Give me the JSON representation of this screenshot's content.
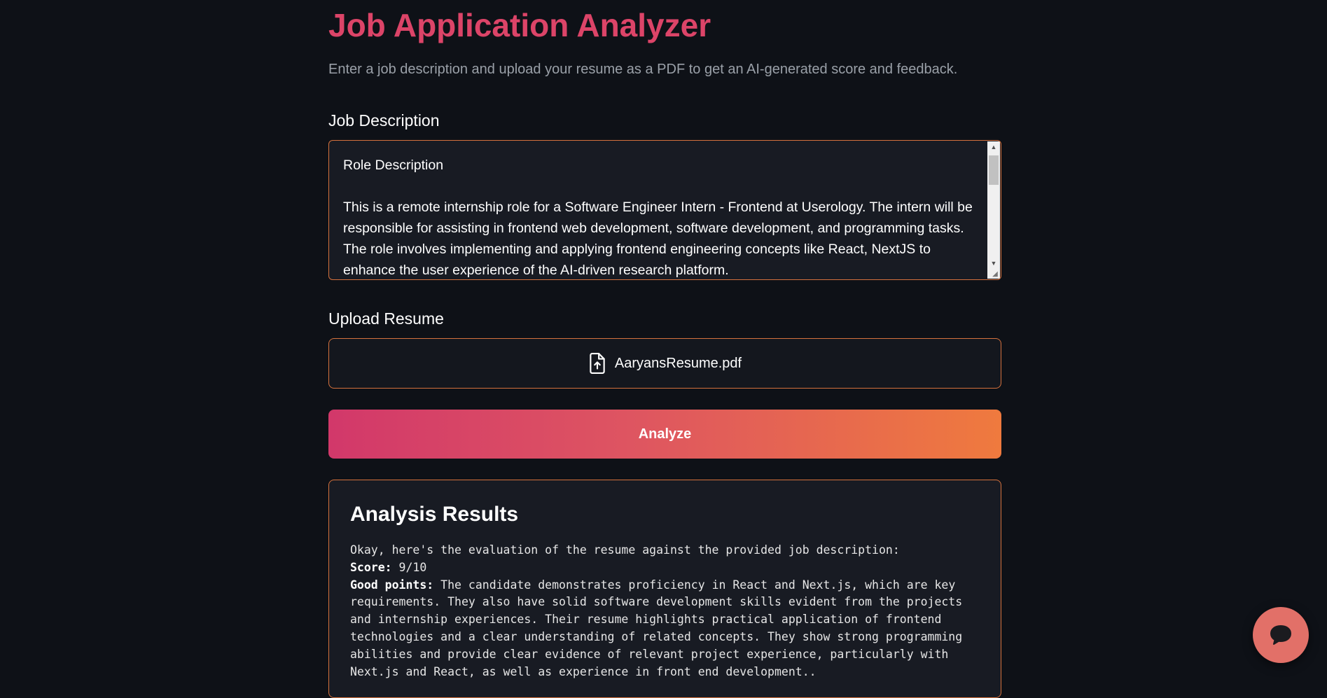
{
  "header": {
    "title": "Job Application Analyzer",
    "subtitle": "Enter a job description and upload your resume as a PDF to get an AI-generated score and feedback."
  },
  "job_description": {
    "label": "Job Description",
    "value": "Role Description\n\nThis is a remote internship role for a Software Engineer Intern - Frontend at Userology. The intern will be responsible for assisting in frontend web development, software development, and programming tasks. The role involves implementing and applying frontend engineering concepts like React, NextJS to enhance the user experience of the AI-driven research platform."
  },
  "upload": {
    "label": "Upload Resume",
    "file_name": "AaryansResume.pdf",
    "icon": "file-upload-icon"
  },
  "analyze_button": {
    "label": "Analyze",
    "gradient_start": "#d2386a",
    "gradient_end": "#ef7a3e"
  },
  "results": {
    "title": "Analysis Results",
    "intro": "Okay, here's the evaluation of the resume against the provided job description:",
    "score_label": "Score:",
    "score_value": " 9/10",
    "good_points_label": "Good points:",
    "good_points_text": " The candidate demonstrates proficiency in React and Next.js, which are key requirements. They also have solid software development skills evident from the projects and internship experiences. Their resume highlights practical application of frontend technologies and a clear understanding of related concepts. They show strong programming abilities and provide clear evidence of relevant project experience, particularly with Next.js and React, as well as experience in front end development.."
  },
  "chat": {
    "icon": "chat-bubble-icon",
    "color": "#e27068"
  },
  "colors": {
    "background": "#0e1117",
    "accent_title": "#dc4468",
    "border": "#d4713d"
  }
}
